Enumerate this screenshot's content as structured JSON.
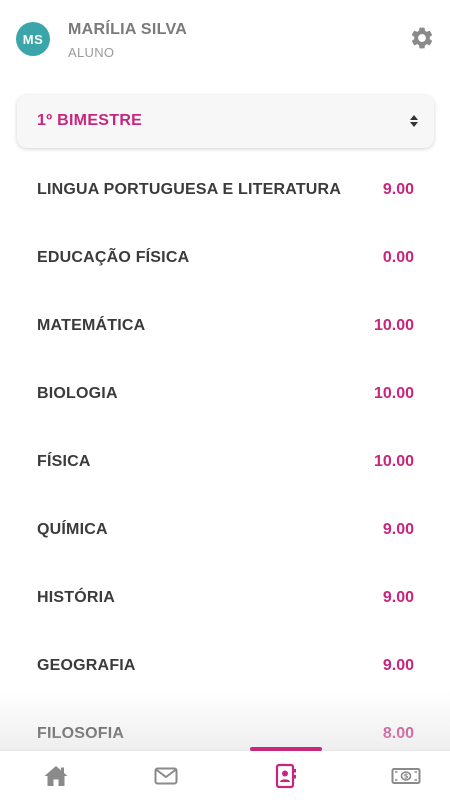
{
  "user": {
    "initials": "MS",
    "name": "MARÍLIA SILVA",
    "role": "ALUNO",
    "avatar_color": "#3aa6a9"
  },
  "period_select": {
    "selected": "1º BIMESTRE"
  },
  "grades": [
    {
      "subject": "LINGUA PORTUGUESA E LITERATURA",
      "grade": "9.00"
    },
    {
      "subject": "EDUCAÇÃO FÍSICA",
      "grade": "0.00"
    },
    {
      "subject": "MATEMÁTICA",
      "grade": "10.00"
    },
    {
      "subject": "BIOLOGIA",
      "grade": "10.00"
    },
    {
      "subject": "FÍSICA",
      "grade": "10.00"
    },
    {
      "subject": "QUÍMICA",
      "grade": "9.00"
    },
    {
      "subject": "HISTÓRIA",
      "grade": "9.00"
    },
    {
      "subject": "GEOGRAFIA",
      "grade": "9.00"
    },
    {
      "subject": "FILOSOFIA",
      "grade": "8.00"
    }
  ],
  "navigation": {
    "items": [
      {
        "icon": "home-icon",
        "active": false
      },
      {
        "icon": "mail-icon",
        "active": false
      },
      {
        "icon": "report-card-icon",
        "active": true
      },
      {
        "icon": "money-icon",
        "active": false
      }
    ]
  },
  "colors": {
    "accent": "#c8267e",
    "subject_text": "#3b3b3b",
    "muted_text": "#7a7a7a",
    "icon_gray": "#8a8a8a"
  }
}
